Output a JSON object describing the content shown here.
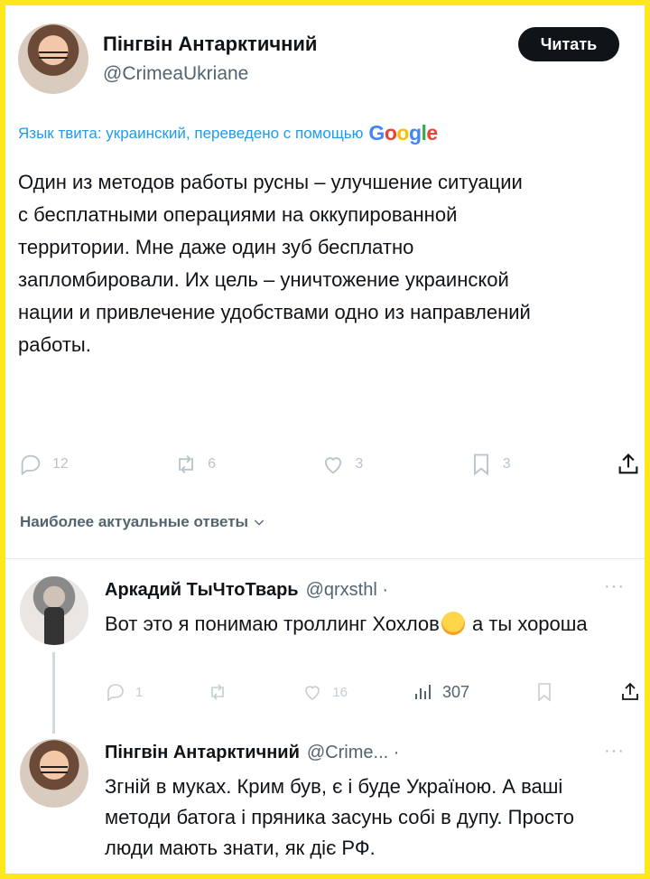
{
  "tweet": {
    "author_name": "Пінгвін Антарктичний",
    "author_handle": "@CrimeaUkriane",
    "follow_label": "Читать",
    "translation_note": "Язык твита: украинский, переведено с помощью",
    "translation_brand": "Google",
    "body": "Один из методов работы русны – улучшение ситуации\nс бесплатными операциями на оккупированной\nтерритории. Мне даже один зуб бесплатно\nзапломбировали. Их цель – уничтожение украинской\nнации и привлечение удобствами одно из направлений\nработы.",
    "stats": {
      "replies": "12",
      "reposts": "6",
      "likes": "3",
      "bookmarks": "3"
    }
  },
  "replies_section": {
    "label": "Наиболее актуальные ответы"
  },
  "replies": [
    {
      "author_name": "Аркадий ТыЧтоТварь",
      "author_handle": "@qrxsthl ·",
      "text_before_emoji": "Вот это я понимаю троллинг Хохлов",
      "text_after_emoji": " а ты хороша",
      "emoji": "smiling-face-emoji",
      "stats": {
        "replies": "1",
        "reposts": "",
        "likes": "16",
        "views": "307"
      }
    },
    {
      "author_name": "Пінгвін Антарктичний",
      "author_handle": "@Crime... ·",
      "text": "Згній в муках. Крим був, є і буде Україною. А ваші методи батога і пряника засунь собі в дупу. Просто люди мають знати, як діє РФ."
    }
  ],
  "colors": {
    "border": "#ffe81a",
    "link": "#1d9bf0",
    "text": "#0f1419",
    "muted": "#536471"
  }
}
